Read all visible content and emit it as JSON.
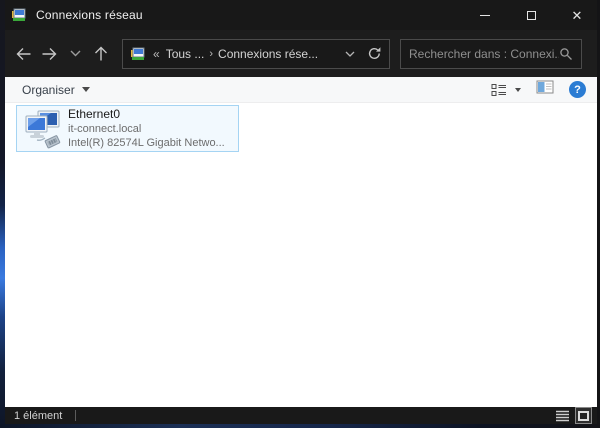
{
  "window": {
    "title": "Connexions réseau"
  },
  "navbar": {
    "breadcrumb": {
      "prefix": "«",
      "first": "Tous ...",
      "separator": "›",
      "current": "Connexions rése..."
    },
    "search_placeholder": "Rechercher dans : Connexi..."
  },
  "toolbar": {
    "organize_label": "Organiser",
    "help_glyph": "?"
  },
  "content": {
    "items": [
      {
        "name": "Ethernet0",
        "network": "it-connect.local",
        "device": "Intel(R) 82574L Gigabit Netwo..."
      }
    ]
  },
  "statusbar": {
    "item_count": "1 élément"
  },
  "icons": {
    "titlebar": "network-connections-icon",
    "nav": [
      "arrow-left",
      "arrow-right",
      "chevron-down",
      "arrow-up",
      "refresh",
      "magnifier"
    ],
    "toolbar_right": [
      "views-list-icon",
      "preview-pane-icon",
      "help-icon"
    ],
    "status_right": [
      "details-view-icon",
      "thumbnails-view-icon"
    ]
  },
  "colors": {
    "titlebar_bg": "#181818",
    "navbar_bg": "#1d1d1d",
    "toolbar_bg": "#f7f8f9",
    "content_bg": "#ffffff",
    "selection_border": "#a5d4f3",
    "selection_fill": "#f2f9fe",
    "help_blue": "#2b7cd3",
    "accent_blue": "#3a7ae0"
  }
}
